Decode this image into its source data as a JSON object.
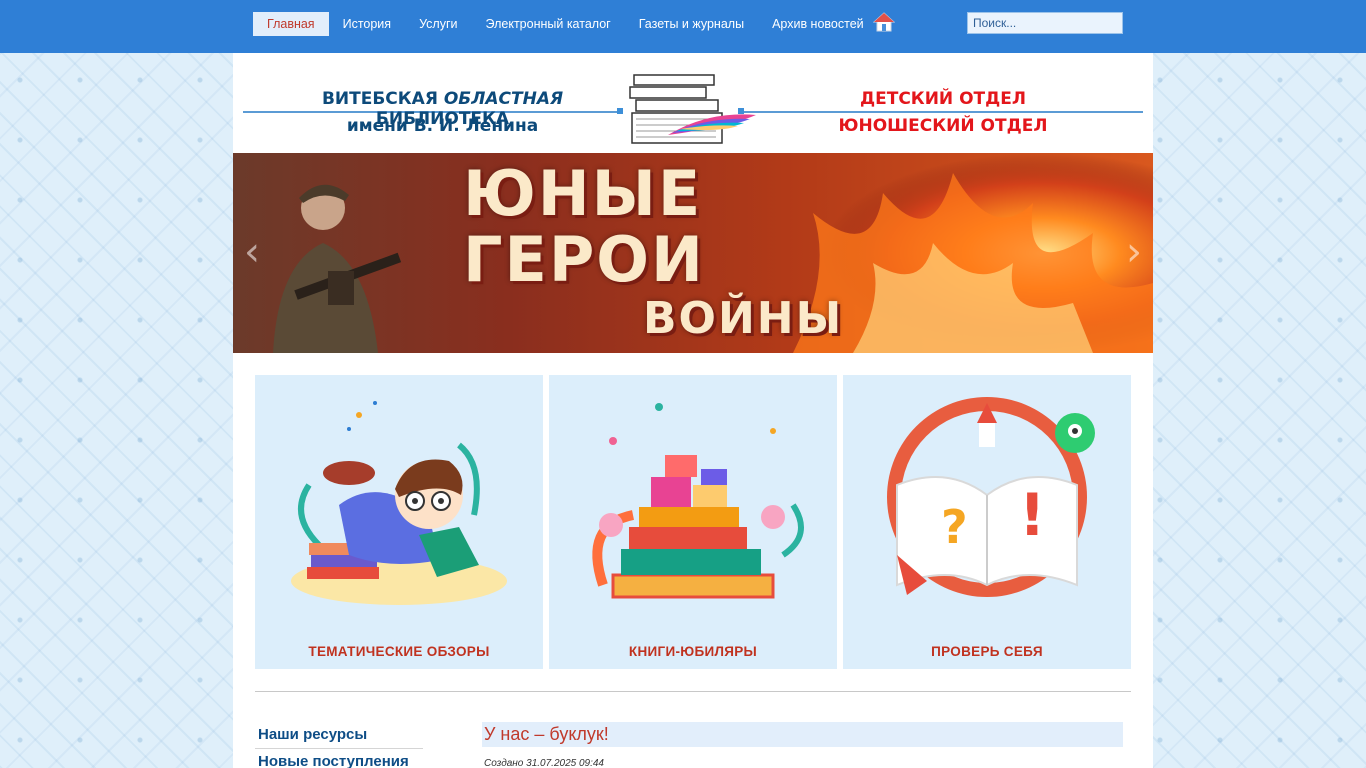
{
  "nav": {
    "items": [
      {
        "label": "Главная",
        "active": true
      },
      {
        "label": "История",
        "active": false
      },
      {
        "label": "Услуги",
        "active": false
      },
      {
        "label": "Электронный каталог",
        "active": false
      },
      {
        "label": "Газеты и журналы",
        "active": false
      },
      {
        "label": "Архив новостей",
        "active": false
      }
    ],
    "home_icon": "home-icon",
    "search_placeholder": "Поиск..."
  },
  "header": {
    "library_line1_a": "ВИТЕБСКАЯ ",
    "library_line1_b": "ОБЛАСТНАЯ",
    "library_line1_c": " БИБЛИОТЕКА",
    "library_line2": "имени В. И. Ленина",
    "dept1": "ДЕТСКИЙ ОТДЕЛ",
    "dept2": "ЮНОШЕСКИЙ ОТДЕЛ"
  },
  "banner": {
    "line1": "ЮНЫЕ",
    "line2": "ГЕРОИ",
    "line3": "ВОЙНЫ",
    "prev_icon": "chevron-left-icon",
    "next_icon": "chevron-right-icon"
  },
  "cards": [
    {
      "label": "ТЕМАТИЧЕСКИЕ ОБЗОРЫ",
      "icon": "reading-boy-illustration"
    },
    {
      "label": "КНИГИ-ЮБИЛЯРЫ",
      "icon": "book-stack-gifts-illustration"
    },
    {
      "label": "ПРОВЕРЬ СЕБЯ",
      "icon": "quiz-book-illustration"
    }
  ],
  "sidebar": {
    "items": [
      "Наши ресурсы",
      "Новые поступления"
    ]
  },
  "article": {
    "title": "У нас – буклук!",
    "meta": "Создано 31.07.2025 09:44"
  },
  "colors": {
    "topbar": "#2f7fd6",
    "accent_red": "#c0321f",
    "header_blue": "#0d4a7a",
    "card_bg": "#dceefb"
  }
}
